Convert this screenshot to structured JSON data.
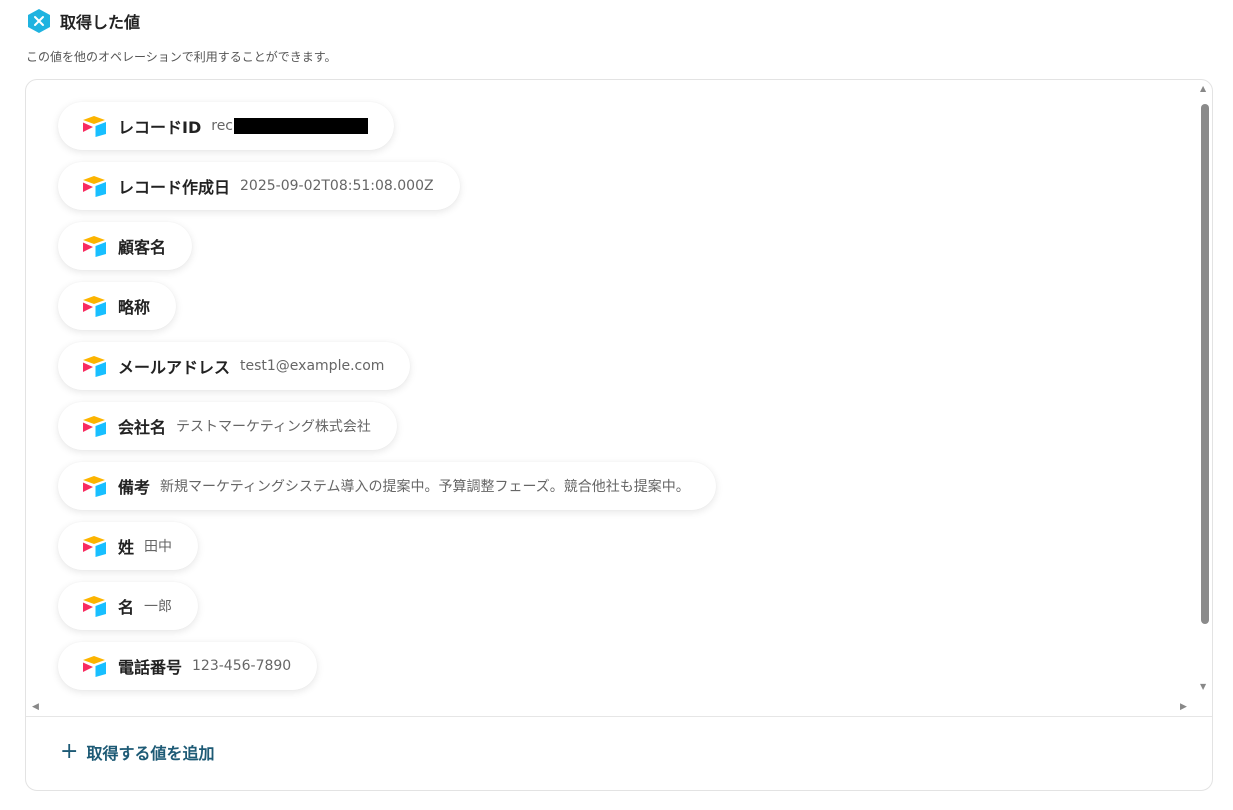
{
  "header": {
    "title": "取得した値",
    "description": "この値を他のオペレーションで利用することができます。"
  },
  "fields": [
    {
      "label": "レコードID",
      "value": "rec",
      "redacted": true
    },
    {
      "label": "レコード作成日",
      "value": "2025-09-02T08:51:08.000Z"
    },
    {
      "label": "顧客名",
      "value": ""
    },
    {
      "label": "略称",
      "value": ""
    },
    {
      "label": "メールアドレス",
      "value": "test1@example.com"
    },
    {
      "label": "会社名",
      "value": "テストマーケティング株式会社"
    },
    {
      "label": "備考",
      "value": "新規マーケティングシステム導入の提案中。予算調整フェーズ。競合他社も提案中。"
    },
    {
      "label": "姓",
      "value": "田中"
    },
    {
      "label": "名",
      "value": "一郎"
    },
    {
      "label": "電話番号",
      "value": "123-456-7890"
    }
  ],
  "footer": {
    "add_label": "取得する値を追加"
  },
  "icons": {
    "header": "close-badge-icon",
    "field": "airtable-logo-icon",
    "add": "plus-icon"
  },
  "colors": {
    "accent": "#1fb3e0",
    "add_text": "#1d5a75"
  }
}
